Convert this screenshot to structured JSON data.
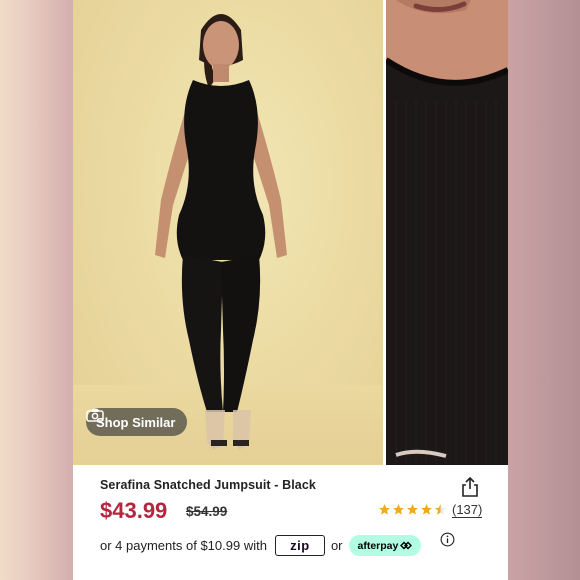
{
  "photo_main": {
    "shop_similar_label": "Shop Similar",
    "camera_icon": "camera-search-icon"
  },
  "product": {
    "title": "Serafina Snatched Jumpsuit - Black",
    "price": "$43.99",
    "original_price": "$54.99",
    "rating": 4.5,
    "review_count": "(137)",
    "share_icon": "share-icon"
  },
  "payments": {
    "prefix": "or 4 payments of $10.99 with",
    "zip_label": "zip",
    "separator": "or",
    "afterpay_label": "afterpay",
    "info_icon": "info-icon"
  },
  "colors": {
    "price": "#b3263e",
    "star": "#f4a81d",
    "afterpay_bg": "#b2fce4",
    "shop_similar_bg": "#505046"
  }
}
